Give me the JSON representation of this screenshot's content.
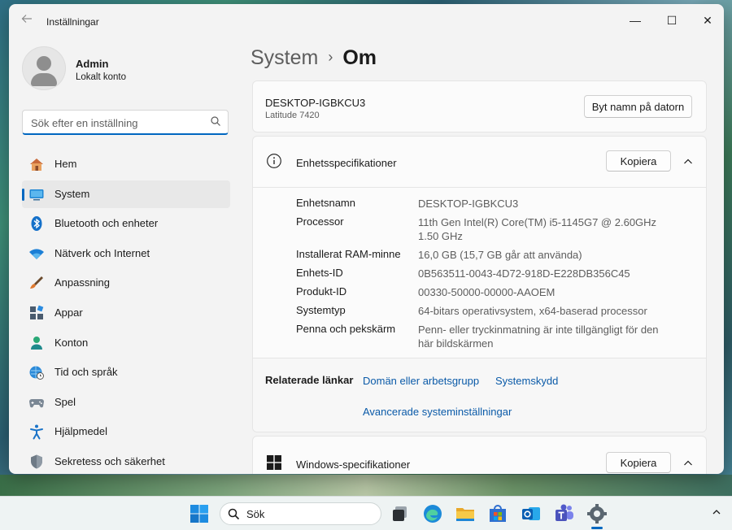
{
  "window": {
    "app_title": "Inställningar",
    "controls": {
      "minimize": "—",
      "maximize": "☐",
      "close": "✕"
    }
  },
  "profile": {
    "name": "Admin",
    "account_type": "Lokalt konto"
  },
  "search": {
    "placeholder": "Sök efter en inställning"
  },
  "nav": {
    "items": [
      {
        "label": "Hem",
        "icon": "home-icon"
      },
      {
        "label": "System",
        "icon": "system-icon",
        "active": true
      },
      {
        "label": "Bluetooth och enheter",
        "icon": "bluetooth-icon"
      },
      {
        "label": "Nätverk och Internet",
        "icon": "wifi-icon"
      },
      {
        "label": "Anpassning",
        "icon": "brush-icon"
      },
      {
        "label": "Appar",
        "icon": "apps-icon"
      },
      {
        "label": "Konton",
        "icon": "account-icon"
      },
      {
        "label": "Tid och språk",
        "icon": "globe-clock-icon"
      },
      {
        "label": "Spel",
        "icon": "gamepad-icon"
      },
      {
        "label": "Hjälpmedel",
        "icon": "accessibility-icon"
      },
      {
        "label": "Sekretess och säkerhet",
        "icon": "shield-icon"
      }
    ]
  },
  "breadcrumb": {
    "parent": "System",
    "separator": "›",
    "current": "Om"
  },
  "device": {
    "name": "DESKTOP-IGBKCU3",
    "model": "Latitude 7420",
    "rename_button": "Byt namn på datorn"
  },
  "device_specs": {
    "title": "Enhetsspecifikationer",
    "copy_button": "Kopiera",
    "rows": [
      {
        "label": "Enhetsnamn",
        "value": "DESKTOP-IGBKCU3"
      },
      {
        "label": "Processor",
        "value": "11th Gen Intel(R) Core(TM) i5-1145G7 @ 2.60GHz   1.50 GHz"
      },
      {
        "label": "Installerat RAM-minne",
        "value": "16,0 GB (15,7 GB går att använda)"
      },
      {
        "label": "Enhets-ID",
        "value": "0B563511-0043-4D72-918D-E228DB356C45"
      },
      {
        "label": "Produkt-ID",
        "value": "00330-50000-00000-AAOEM"
      },
      {
        "label": "Systemtyp",
        "value": "64-bitars operativsystem, x64-baserad processor"
      },
      {
        "label": "Penna och pekskärm",
        "value": "Penn- eller tryckinmatning är inte tillgängligt för den här bildskärmen"
      }
    ],
    "related": {
      "title": "Relaterade länkar",
      "links": [
        "Domän eller arbetsgrupp",
        "Systemskydd",
        "Avancerade systeminställningar"
      ]
    }
  },
  "windows_specs": {
    "title": "Windows-specifikationer",
    "copy_button": "Kopiera"
  },
  "taskbar": {
    "search_text": "Sök",
    "apps": [
      "start-icon",
      "task-view-icon",
      "edge-icon",
      "file-explorer-icon",
      "store-icon",
      "outlook-icon",
      "teams-icon",
      "settings-icon"
    ]
  },
  "colors": {
    "accent": "#0067c0",
    "link": "#0a5aa8"
  }
}
